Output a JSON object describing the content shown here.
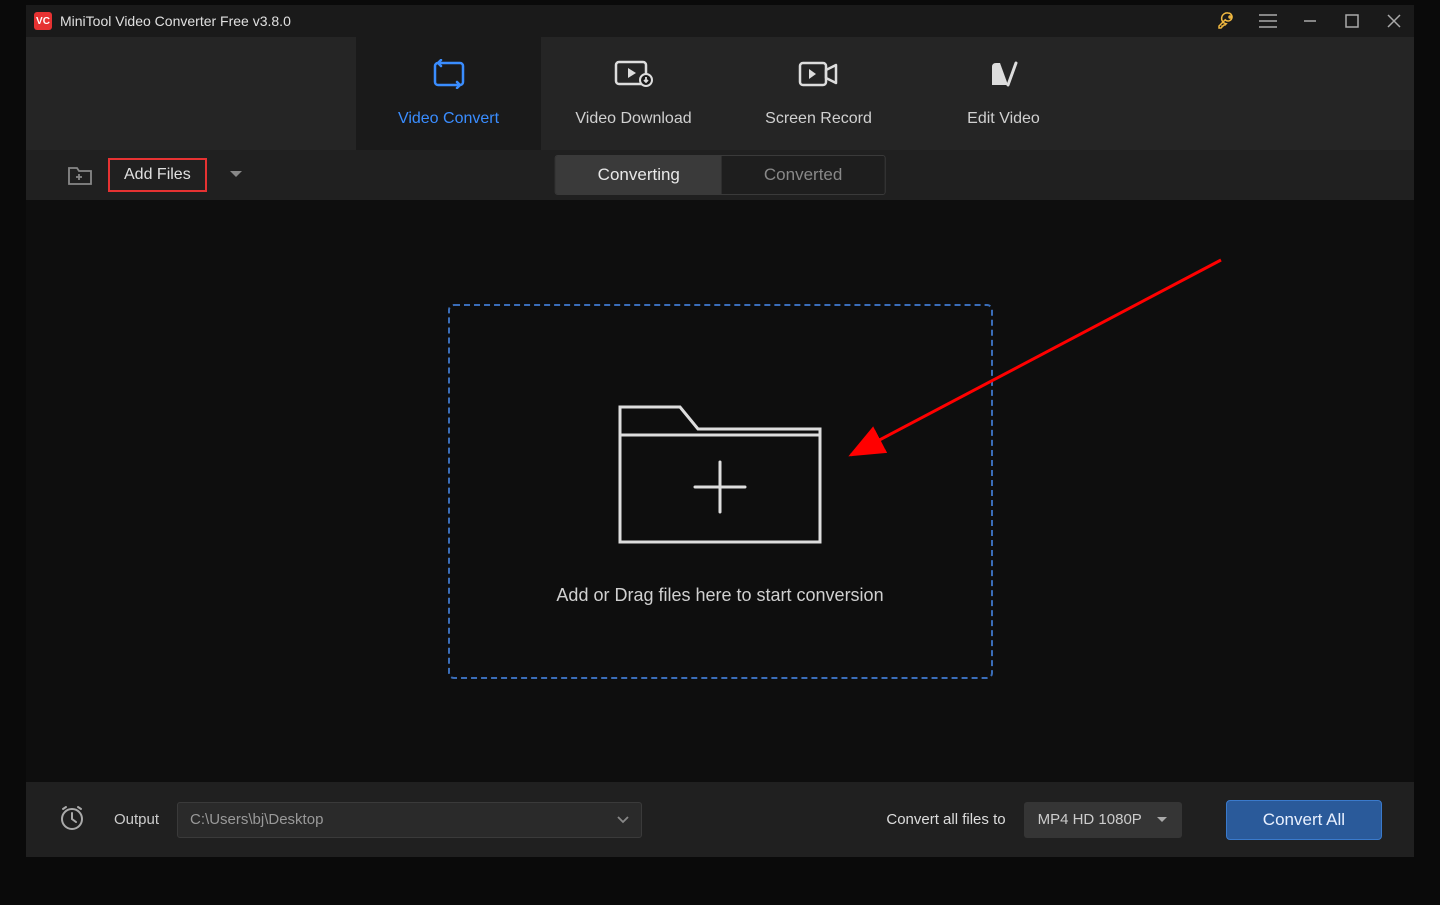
{
  "titlebar": {
    "app_name": "VC",
    "title": "MiniTool Video Converter Free v3.8.0"
  },
  "nav": {
    "tabs": [
      {
        "label": "Video Convert",
        "icon": "video-convert-icon"
      },
      {
        "label": "Video Download",
        "icon": "video-download-icon"
      },
      {
        "label": "Screen Record",
        "icon": "screen-record-icon"
      },
      {
        "label": "Edit Video",
        "icon": "edit-video-icon"
      }
    ]
  },
  "toolbar": {
    "add_files_label": "Add Files",
    "sub_tabs": [
      {
        "label": "Converting"
      },
      {
        "label": "Converted"
      }
    ]
  },
  "dropzone": {
    "text": "Add or Drag files here to start conversion"
  },
  "footer": {
    "output_label": "Output",
    "output_path": "C:\\Users\\bj\\Desktop",
    "convert_label": "Convert all files to",
    "format": "MP4 HD 1080P",
    "convert_all_label": "Convert All"
  }
}
